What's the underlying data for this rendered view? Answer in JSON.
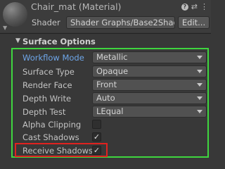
{
  "header": {
    "title": "Chair_mat (Material)",
    "shader_label": "Shader",
    "shader_value": "Shader Graphs/Base2Shad",
    "edit_label": "Edit..."
  },
  "section": {
    "title": "Surface Options"
  },
  "rows": [
    {
      "label": "Workflow Mode",
      "value": "Metallic"
    },
    {
      "label": "Surface Type",
      "value": "Opaque"
    },
    {
      "label": "Render Face",
      "value": "Front"
    },
    {
      "label": "Depth Write",
      "value": "Auto"
    },
    {
      "label": "Depth Test",
      "value": "LEqual"
    },
    {
      "label": "Alpha Clipping",
      "checked": false
    },
    {
      "label": "Cast Shadows",
      "checked": true
    },
    {
      "label": "Receive Shadows",
      "checked": true
    }
  ],
  "colors": {
    "highlight_box": "#3fd63f",
    "receive_shadows_box": "#e0221f",
    "active_label": "#6fa6e9"
  }
}
